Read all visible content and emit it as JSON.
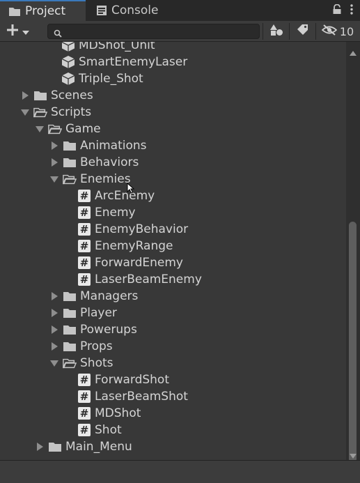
{
  "tabs": {
    "project": "Project",
    "console": "Console"
  },
  "toolbar": {
    "search_placeholder": "",
    "hidden_count": "10"
  },
  "tree": [
    {
      "label": "MDShot_Unit",
      "type": "prefab",
      "depth": 3
    },
    {
      "label": "SmartEnemyLaser",
      "type": "prefab",
      "depth": 3
    },
    {
      "label": "Triple_Shot",
      "type": "prefab",
      "depth": 3
    },
    {
      "label": "Scenes",
      "type": "folder",
      "depth": 1,
      "state": "collapsed"
    },
    {
      "label": "Scripts",
      "type": "folder",
      "depth": 1,
      "state": "expanded"
    },
    {
      "label": "Game",
      "type": "folder",
      "depth": 2,
      "state": "expanded"
    },
    {
      "label": "Animations",
      "type": "folder",
      "depth": 3,
      "state": "collapsed"
    },
    {
      "label": "Behaviors",
      "type": "folder",
      "depth": 3,
      "state": "collapsed"
    },
    {
      "label": "Enemies",
      "type": "folder",
      "depth": 3,
      "state": "expanded"
    },
    {
      "label": "ArcEnemy",
      "type": "script",
      "depth": 4
    },
    {
      "label": "Enemy",
      "type": "script",
      "depth": 4
    },
    {
      "label": "EnemyBehavior",
      "type": "script",
      "depth": 4
    },
    {
      "label": "EnemyRange",
      "type": "script",
      "depth": 4
    },
    {
      "label": "ForwardEnemy",
      "type": "script",
      "depth": 4
    },
    {
      "label": "LaserBeamEnemy",
      "type": "script",
      "depth": 4
    },
    {
      "label": "Managers",
      "type": "folder",
      "depth": 3,
      "state": "collapsed"
    },
    {
      "label": "Player",
      "type": "folder",
      "depth": 3,
      "state": "collapsed"
    },
    {
      "label": "Powerups",
      "type": "folder",
      "depth": 3,
      "state": "collapsed"
    },
    {
      "label": "Props",
      "type": "folder",
      "depth": 3,
      "state": "collapsed"
    },
    {
      "label": "Shots",
      "type": "folder",
      "depth": 3,
      "state": "expanded"
    },
    {
      "label": "ForwardShot",
      "type": "script",
      "depth": 4
    },
    {
      "label": "LaserBeamShot",
      "type": "script",
      "depth": 4
    },
    {
      "label": "MDShot",
      "type": "script",
      "depth": 4
    },
    {
      "label": "Shot",
      "type": "script",
      "depth": 4
    },
    {
      "label": "Main_Menu",
      "type": "folder",
      "depth": 2,
      "state": "collapsed"
    }
  ],
  "colors": {
    "panel": "#383838",
    "tabbar": "#282828",
    "active_tab_accent": "#3a79bb",
    "text": "#d4d4d4"
  }
}
